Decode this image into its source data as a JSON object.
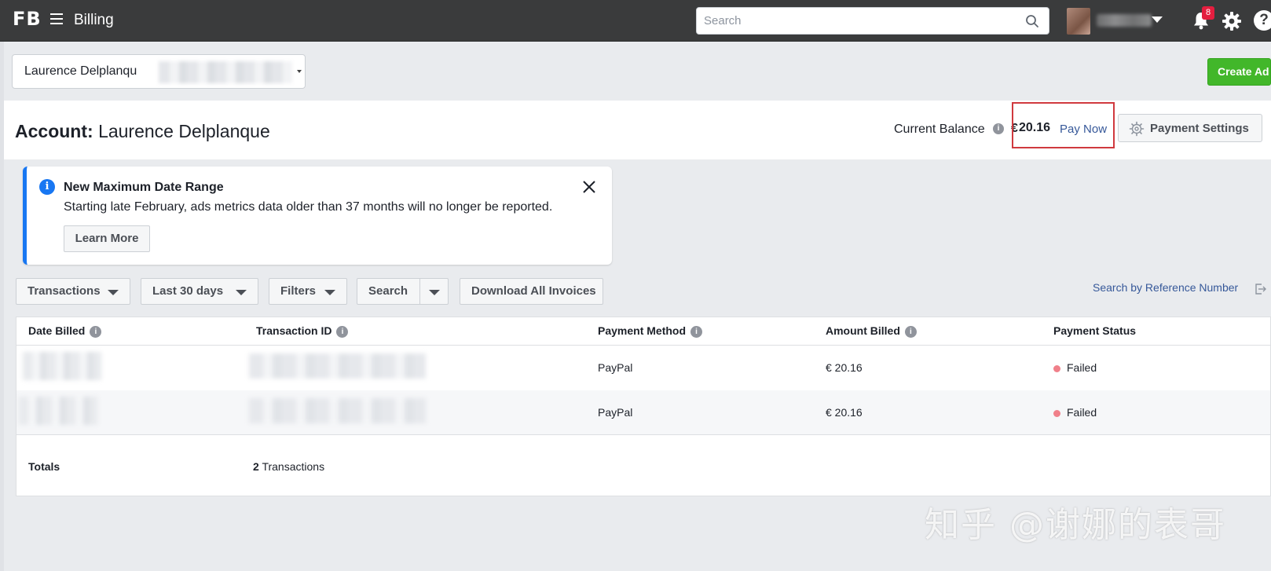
{
  "topbar": {
    "logo": "FB",
    "app_title": "Billing",
    "search_placeholder": "Search",
    "notification_count": "8"
  },
  "account_selector": {
    "value": "Laurence Delplanqu"
  },
  "create_ad_label": "Create Ad",
  "account_header": {
    "prefix": "Account:",
    "name": "Laurence Delplanque",
    "balance_label": "Current Balance",
    "currency": "€",
    "balance": "20.16",
    "pay_now": "Pay Now",
    "payment_settings": "Payment Settings"
  },
  "notice": {
    "title": "New Maximum Date Range",
    "body": "Starting late February, ads metrics data older than 37 months will no longer be reported.",
    "learn_more": "Learn More"
  },
  "toolbar": {
    "transactions": "Transactions",
    "date_range": "Last 30 days",
    "filters": "Filters",
    "search": "Search",
    "download": "Download All Invoices",
    "ref_search": "Search by Reference Number"
  },
  "table": {
    "columns": [
      "Date Billed",
      "Transaction ID",
      "Payment Method",
      "Amount Billed",
      "Payment Status"
    ],
    "rows": [
      {
        "method": "PayPal",
        "amount": "€ 20.16",
        "status": "Failed"
      },
      {
        "method": "PayPal",
        "amount": "€ 20.16",
        "status": "Failed"
      }
    ],
    "totals_label": "Totals",
    "totals_count": "2",
    "totals_suffix": "Transactions"
  },
  "watermark": "知乎 @谢娜的表哥",
  "colors": {
    "topbar": "#3a3b3c",
    "link": "#365899",
    "create_ad": "#42b72a",
    "notice_accent": "#1877f2",
    "failed_dot": "#f0808a",
    "highlight_border": "#d0393e"
  }
}
